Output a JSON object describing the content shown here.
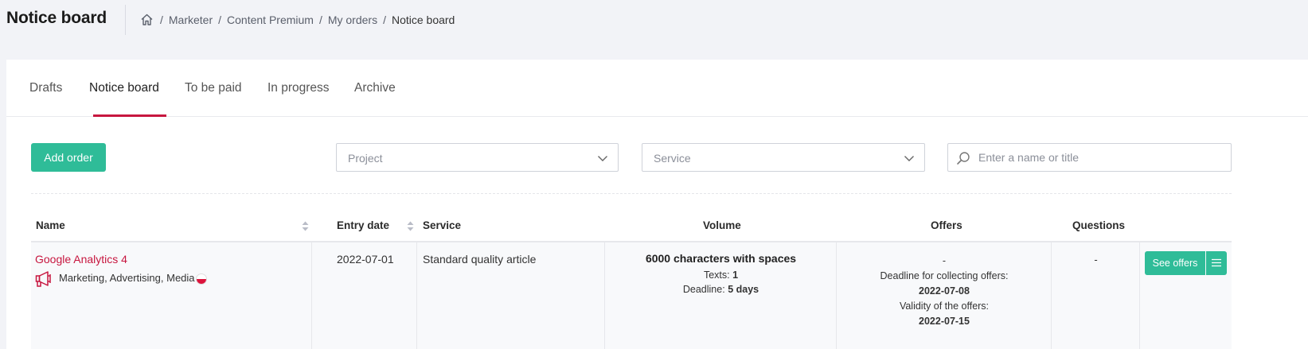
{
  "header": {
    "title": "Notice board",
    "breadcrumb": [
      "Marketer",
      "Content Premium",
      "My orders"
    ],
    "breadcrumb_current": "Notice board"
  },
  "tabs": [
    {
      "label": "Drafts"
    },
    {
      "label": "Notice board",
      "active": true
    },
    {
      "label": "To be paid"
    },
    {
      "label": "In progress"
    },
    {
      "label": "Archive"
    }
  ],
  "toolbar": {
    "add_label": "Add order",
    "project_placeholder": "Project",
    "service_placeholder": "Service",
    "search_placeholder": "Enter a name or title"
  },
  "table": {
    "columns": {
      "name": "Name",
      "entry_date": "Entry date",
      "service": "Service",
      "volume": "Volume",
      "offers": "Offers",
      "questions": "Questions"
    },
    "rows": [
      {
        "name": "Google Analytics 4",
        "categories": "Marketing, Advertising, Media",
        "entry_date": "2022-07-01",
        "service": "Standard quality article",
        "volume": "6000 characters with spaces",
        "texts_label": "Texts:",
        "texts_value": "1",
        "deadline_label": "Deadline:",
        "deadline_value": "5 days",
        "offers_count": "-",
        "collect_label": "Deadline for collecting offers:",
        "collect_value": "2022-07-08",
        "validity_label": "Validity of the offers:",
        "validity_value": "2022-07-15",
        "questions": "-",
        "action_label": "See offers"
      }
    ]
  },
  "colors": {
    "accent": "#c7163f",
    "primary_button": "#2fbc98"
  }
}
